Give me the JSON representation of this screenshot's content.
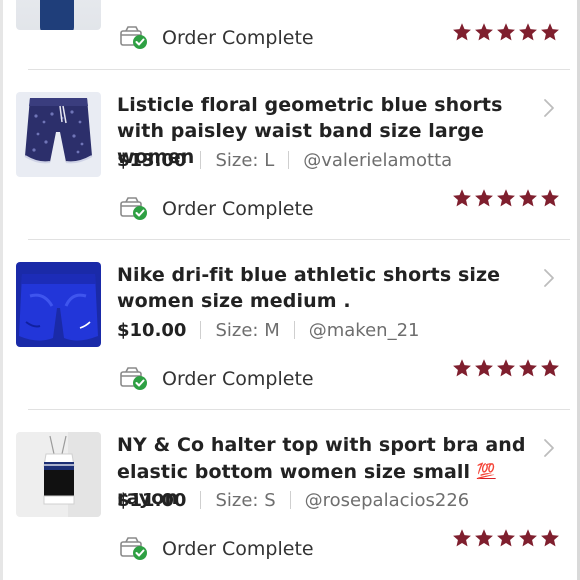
{
  "colors": {
    "star": "#7f1f2e",
    "check_badge": "#2ea043",
    "divider": "#e1e1e1",
    "muted_text": "#6e6e6e"
  },
  "orders": [
    {
      "status": "Order Complete",
      "rating": 5,
      "partial": true
    },
    {
      "title": "Listicle floral geometric blue shorts with paisley waist band size large women",
      "price": "$13.00",
      "size": "Size: L",
      "seller": "@valerielamotta",
      "status": "Order Complete",
      "rating": 5
    },
    {
      "title": "Nike dri-fit blue athletic shorts size women size medium .",
      "price": "$10.00",
      "size": "Size: M",
      "seller": "@maken_21",
      "status": "Order Complete",
      "rating": 5
    },
    {
      "title_part1": "NY & Co halter top with sport bra and elastic bottom women size small",
      "title_emoji": "💯",
      "title_part2": "rayon",
      "price": "$11.00",
      "size": "Size: S",
      "seller": "@rosepalacios226",
      "status": "Order Complete",
      "rating": 5
    }
  ],
  "icons": {
    "status": "package-check-icon",
    "chevron": "chevron-right-icon",
    "star": "star-icon"
  }
}
